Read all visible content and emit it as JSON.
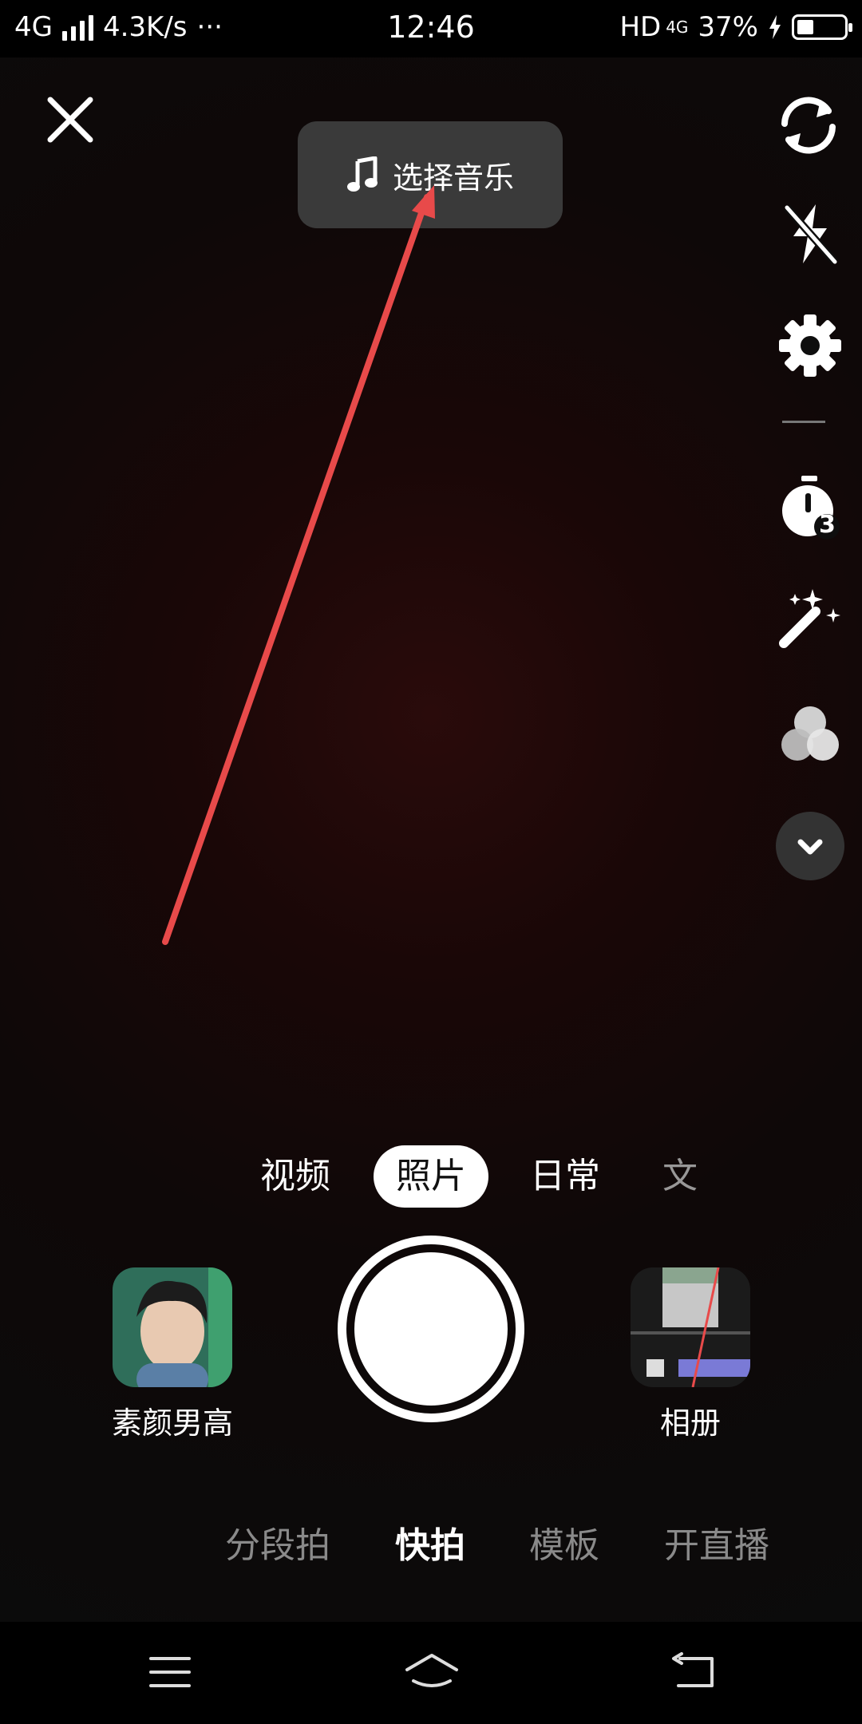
{
  "status_bar": {
    "network": "4G",
    "speed": "4.3K/s",
    "dots": "···",
    "time": "12:46",
    "hd": "HD",
    "net_small": "4G",
    "battery": "37%",
    "battery_level": 0.37
  },
  "top": {
    "music_label": "选择音乐"
  },
  "modes": {
    "tabs": [
      "视频",
      "照片",
      "日常",
      "文"
    ],
    "active": "照片"
  },
  "left_thumb": {
    "label": "素颜男高"
  },
  "right_thumb": {
    "label": "相册"
  },
  "bottom_tabs": {
    "items": [
      "分段拍",
      "快拍",
      "模板",
      "开直播"
    ],
    "active": "快拍"
  },
  "timer_badge": "3",
  "colors": {
    "accent_arrow": "#e84a4a",
    "panel": "#3a3a3a"
  }
}
